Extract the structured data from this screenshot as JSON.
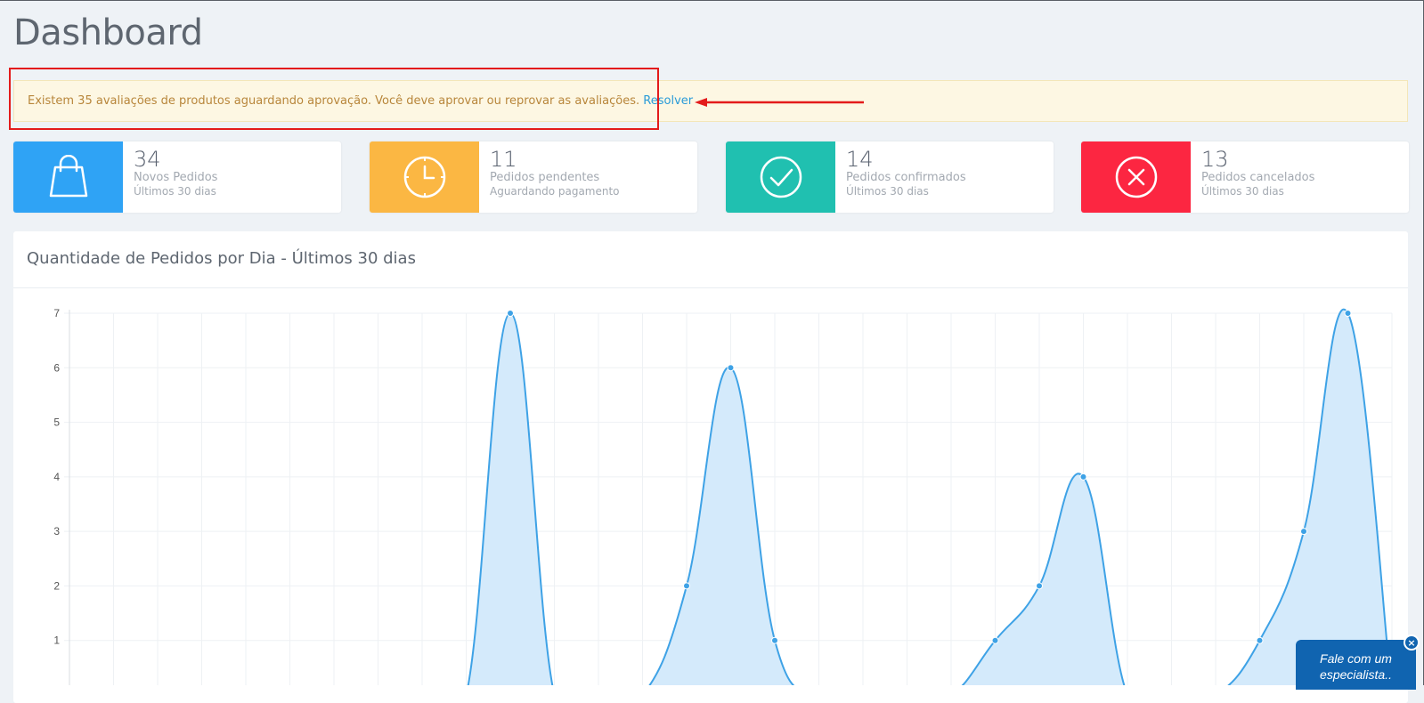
{
  "page": {
    "title": "Dashboard"
  },
  "alert": {
    "message": "Existem 35 avaliações de produtos aguardando aprovação. Você deve aprovar ou reprovar as avaliações.",
    "link_label": "Resolver"
  },
  "annotation": {
    "color": "#e31b1b"
  },
  "stats": [
    {
      "value": "34",
      "label": "Novos Pedidos",
      "sub": "Últimos 30 dias",
      "color": "#2fa3f5",
      "icon": "shopping-bag-icon"
    },
    {
      "value": "11",
      "label": "Pedidos pendentes",
      "sub": "Aguardando pagamento",
      "color": "#fbb743",
      "icon": "clock-icon"
    },
    {
      "value": "14",
      "label": "Pedidos confirmados",
      "sub": "Últimos 30 dias",
      "color": "#20c0b0",
      "icon": "check-circle-icon"
    },
    {
      "value": "13",
      "label": "Pedidos cancelados",
      "sub": "Últimos 30 dias",
      "color": "#fc2641",
      "icon": "x-circle-icon"
    }
  ],
  "chart_panel": {
    "title": "Quantidade de Pedidos por Dia - Últimos 30 dias"
  },
  "chart_data": {
    "type": "area",
    "title": "Quantidade de Pedidos por Dia - Últimos 30 dias",
    "xlabel": "",
    "ylabel": "",
    "ylim": [
      0,
      7
    ],
    "yticks": [
      1,
      2,
      3,
      4,
      5,
      6,
      7
    ],
    "grid": true,
    "x": [
      0,
      1,
      2,
      3,
      4,
      5,
      6,
      7,
      8,
      9,
      10,
      11,
      12,
      13,
      14,
      15,
      16,
      17,
      18,
      19,
      20,
      21,
      22,
      23,
      24,
      25,
      26,
      27,
      28,
      29,
      30
    ],
    "values": [
      0,
      0,
      0,
      0,
      0,
      0,
      0,
      0,
      0,
      0,
      7,
      0,
      0,
      0,
      2,
      6,
      1,
      0,
      0,
      0,
      0,
      1,
      2,
      4,
      0,
      0,
      0,
      1,
      3,
      7,
      0
    ],
    "color": "#3ea2e6",
    "fill": "#d4eafb"
  },
  "chat": {
    "label": "Fale com um especialista..",
    "close_label": "×",
    "color": "#1064b0"
  }
}
